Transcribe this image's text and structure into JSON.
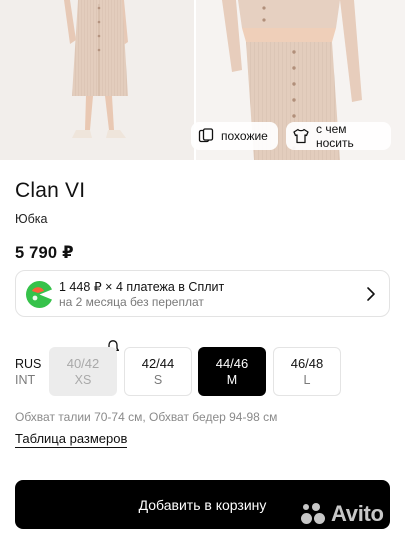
{
  "gallery": {
    "similar_label": "похожие",
    "wear_label": "с чем носить"
  },
  "product": {
    "brand": "Clan VI",
    "category": "Юбка",
    "price": "5 790 ₽"
  },
  "split": {
    "line1": "1 448 ₽ × 4 платежа в Сплит",
    "line2": "на 2 месяца без переплат",
    "accent_color": "#36c24a"
  },
  "sizes": {
    "system_rus": "RUS",
    "system_int": "INT",
    "options": [
      {
        "rus": "40/42",
        "int": "XS",
        "state": "unavailable"
      },
      {
        "rus": "42/44",
        "int": "S",
        "state": "available"
      },
      {
        "rus": "44/46",
        "int": "M",
        "state": "selected"
      },
      {
        "rus": "46/48",
        "int": "L",
        "state": "available"
      }
    ],
    "measurements": "Обхват талии 70-74 см, Обхват бедер 94-98 см",
    "table_link": "Таблица размеров"
  },
  "cart": {
    "label": "Добавить в корзину"
  },
  "watermark": {
    "text": "Avito"
  }
}
